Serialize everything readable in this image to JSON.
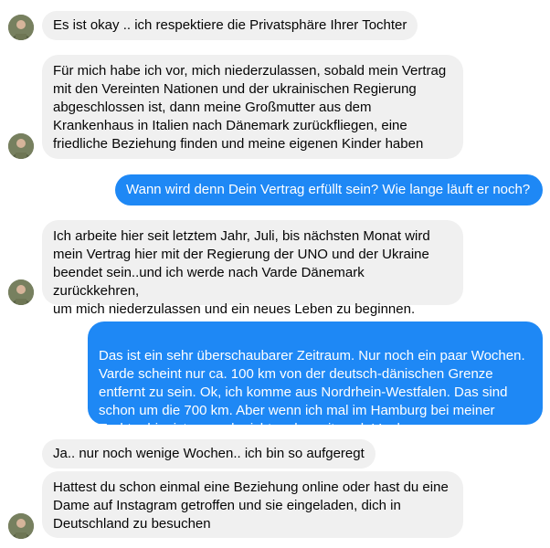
{
  "messages": [
    {
      "id": "m1",
      "side": "incoming",
      "text": "Es ist okay .. ich respektiere die Privatsphäre Ihrer Tochter"
    },
    {
      "id": "m2",
      "side": "incoming",
      "text": "Für mich habe ich vor, mich niederzulassen, sobald mein Vertrag\nmit den Vereinten Nationen und der ukrainischen Regierung\nabgeschlossen ist, dann meine Großmutter aus dem\nKrankenhaus in Italien nach Dänemark zurückfliegen, eine\nfriedliche Beziehung finden und meine eigenen Kinder haben"
    },
    {
      "id": "m3",
      "side": "outgoing",
      "text": "Wann wird denn Dein Vertrag erfüllt sein? Wie lange läuft er noch?"
    },
    {
      "id": "m4",
      "side": "incoming",
      "text": "Ich arbeite hier seit letztem Jahr, Juli, bis nächsten Monat wird\nmein Vertrag hier mit der Regierung der UNO und der Ukraine\nbeendet sein..und ich werde nach Varde Dänemark zurückkehren,\num mich niederzulassen und ein neues Leben zu beginnen."
    },
    {
      "id": "m5",
      "side": "outgoing",
      "text": "Das ist ein sehr überschaubarer Zeitraum. Nur noch ein paar Wochen.\nVarde scheint nur ca. 100 km von der deutsch-dänischen Grenze\nentfernt zu sein. Ok, ich komme aus Nordrhein-Westfalen. Das sind\nschon um die 700 km. Aber wenn ich mal im Hamburg bei meiner\nTochter bin, ist es auch nicht mehr weit nach Varde.",
      "emoji": "grinning-winking-tongue-emoji"
    },
    {
      "id": "m6",
      "side": "incoming",
      "text": "Ja.. nur noch wenige Wochen.. ich bin so aufgeregt"
    },
    {
      "id": "m7",
      "side": "incoming",
      "text": "Hattest du schon einmal eine Beziehung online oder hast du eine\nDame auf Instagram getroffen und sie eingeladen, dich in\nDeutschland zu besuchen"
    }
  ],
  "colors": {
    "incoming_bg": "#f0f0f0",
    "outgoing_bg": "#1e88f5",
    "incoming_text": "#050505",
    "outgoing_text": "#ffffff"
  },
  "icons": {
    "avatar": "contact-avatar",
    "emoji": "grinning-winking-tongue-emoji"
  }
}
